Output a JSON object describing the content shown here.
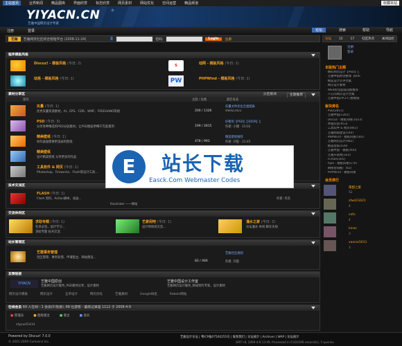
{
  "topnav": {
    "home": "主站首页",
    "items": [
      "业界新闻",
      "精品图库",
      "界面欣赏",
      "标志欣赏",
      "网页素材",
      "网站优化",
      "空间运营",
      "精品频道"
    ],
    "fav": "收藏本站"
  },
  "banner": {
    "logo": "YIYACN.CN",
    "tm": "®",
    "slogan": "艺雅中国网页设计专家"
  },
  "menubar": {
    "left": [
      "注册",
      "登录"
    ],
    "right": [
      "论坛",
      "搜索",
      "帮助",
      "导航"
    ]
  },
  "loginbar": {
    "badge": "艺雅",
    "text": "艺雅网页社区综合管理平台 (2008-11-24)",
    "pwd_label": "密码:",
    "login": "Login",
    "reg": "注册"
  },
  "rightpanel": {
    "tabs": [
      "论坛",
      "浏览",
      "15",
      "17",
      "社区热点",
      "在线统计",
      "公告",
      "关闭边栏"
    ],
    "user_links": [
      "注册",
      "登录"
    ],
    "hot_head": "本版热门主题",
    "hot": [
      "精彩网页设计【PSD】【",
      "艺雅中国原创整理【600",
      "精美设计点评合集",
      "网页设计素材",
      "WEB优化超强功能推荐",
      "人心的网页设计合集",
      "艺雅中国2P(3人)图看版"
    ],
    "stat_head": "板块排名",
    "stats": [
      "PSD(2815)",
      "艺雅中国(1281)",
      "Discuz - 模板风格(1023)",
      "界面欣赏(953)",
      "工具软件 & 网页(841)",
      "艺雅网站建设(540)",
      "PNPWind - 模板风格(544)",
      "艺雅网页设计(482)",
      "精美壁纸(439)",
      "艺雅中国 - 模板(400)",
      "艺雅开发网(343)",
      "FLASH(305)",
      "Ajax - 模板风格(170)",
      "网络营销推广(63)",
      "PHPWind - 模板风格"
    ],
    "members_head": "会员排行",
    "members": [
      {
        "name": "南郡之家",
        "v": "52"
      },
      {
        "name": "sfwd23421",
        "v": "4"
      },
      {
        "name": "cofu",
        "v": "4"
      },
      {
        "name": "kinac",
        "v": "3"
      },
      {
        "name": "xaoros5011",
        "v": "3"
      }
    ]
  },
  "sections": {
    "template": {
      "title": "程序模板风格",
      "items": [
        {
          "name": "Discuz! - 模板风格",
          "today": "(今日: 2)"
        },
        {
          "name": "动网 - 模板风格",
          "today": "(今日: 1)"
        },
        {
          "name": "动易 - 模板风格",
          "today": "(今日: 1)"
        },
        {
          "name": "PHPWind - 模板风格",
          "today": "(今日: 1)"
        }
      ]
    },
    "material": {
      "title": "素材分享区",
      "tabs": [
        "分区版块",
        "主题推荐"
      ],
      "cols": [
        "版块",
        "主题 / 帖数",
        "最后发表"
      ],
      "rows": [
        {
          "name": "矢量",
          "today": "(今日: 1)",
          "desc": "优秀矢量资源素材，AI、EPS、CDR、WMF、FREEHAND等格",
          "posts": "200 / 1326",
          "last": "矢量文件优化全面图表",
          "by": "sfwd23421"
        },
        {
          "name": "PSD",
          "today": "(今日: 3)",
          "desc": "分享各种精选的PSD分层素材，让PSD图层更细于完美看到",
          "posts": "199 / 2815",
          "last": "好看的【PSD】【3DDR】【",
          "by": "作者: 小猪 · 15:02"
        },
        {
          "name": "精美壁纸",
          "today": "(今日: 1)",
          "desc": "你的桌面需要更美丽的壁纸",
          "posts": "478 / 993",
          "last": "精美壁纸推荐",
          "by": "作者: 刘虫 · 21:45"
        },
        {
          "name": "精美壁纸",
          "today": "",
          "desc": "设计精美壁纸 分享更多的作品 ",
          "posts": "",
          "last": "精美网站素材合集",
          "by": "作者: 刘虫"
        },
        {
          "name": "工具软件 & 网页",
          "today": "(今日: 1)",
          "desc": "Photoshop、Fireworks、Flash等设计工具...",
          "posts": "",
          "last": "",
          "by": ""
        }
      ]
    },
    "tech": {
      "title": "技术交流区",
      "rows": [
        {
          "name": "FLASH",
          "today": "(今日: 1)",
          "desc": "Flash 资料、Action脚本、动画...",
          "last": "Illustrator 一一网站 ",
          "by": "作者: 杰名"
        }
      ]
    },
    "exchange": {
      "title": "交流休闲区",
      "items": [
        {
          "name": "求助专题",
          "today": "(今日: 1)",
          "desc": "有求必答，设计学习...",
          "desc2": "求助专题 技术交流"
        },
        {
          "name": "艺家闲吧",
          "today": "(今日: 1)",
          "desc": "设计师休闲交流..."
        },
        {
          "name": "灌水之家",
          "today": "(今日: 2)",
          "desc": "论坛灌水 休闲 聊天天地"
        }
      ]
    },
    "ops": {
      "title": "站长管理区",
      "rows": [
        {
          "name": "艺雅事务管理",
          "desc": "社区管理、事务处理、申请版主、网站建设...",
          "posts": "82 / 466",
          "last": "艺雅社区规则",
          "by": "作者: 刘虫"
        }
      ]
    },
    "links": {
      "title": "友情链接",
      "items": [
        {
          "name": "艺雅中国原创",
          "desc": "艺雅网页设计服务_PSD素材分享，设计素材"
        },
        {
          "name": "艺雅中国设计工作室",
          "desc": "艺雅网页设计服务_网站制作专家，设计素材"
        }
      ],
      "extra": [
        "网页设计模板",
        "网页设计",
        "五单设计",
        "网页优化",
        "艺雅素材",
        "Google排名",
        "Robots网站"
      ]
    },
    "online": {
      "title": "在线会员",
      "text": "69 人在线 - 1 会员(0 隐身), 68 位游客 - 最高记录是 1112 于 2008-4-9",
      "legend": [
        "管理员",
        "超级版主",
        "版主",
        "会员"
      ],
      "user": "sfgvw45434"
    }
  },
  "footer": {
    "left": "Powered by Discuz! 7.0.0",
    "copy": "© 2001-2009 Comsenz Inc.",
    "right": "艺雅设计论坛 | 粤ICP备07500255号 | 联系我们 | 论坛统计 | Archiver | WAP | 论坛统计",
    "right2": "GMT+8, 2009-4-8 13:49, Processed in 0.024196 second(s), 5 queries."
  },
  "watermark": {
    "logo": "E",
    "title": "站长下载",
    "sub": "Easck.Com Webmaster Codes"
  },
  "colors": {
    "accent": "#f4a020",
    "header": "#1b64b4",
    "btn": "#e86a10"
  }
}
